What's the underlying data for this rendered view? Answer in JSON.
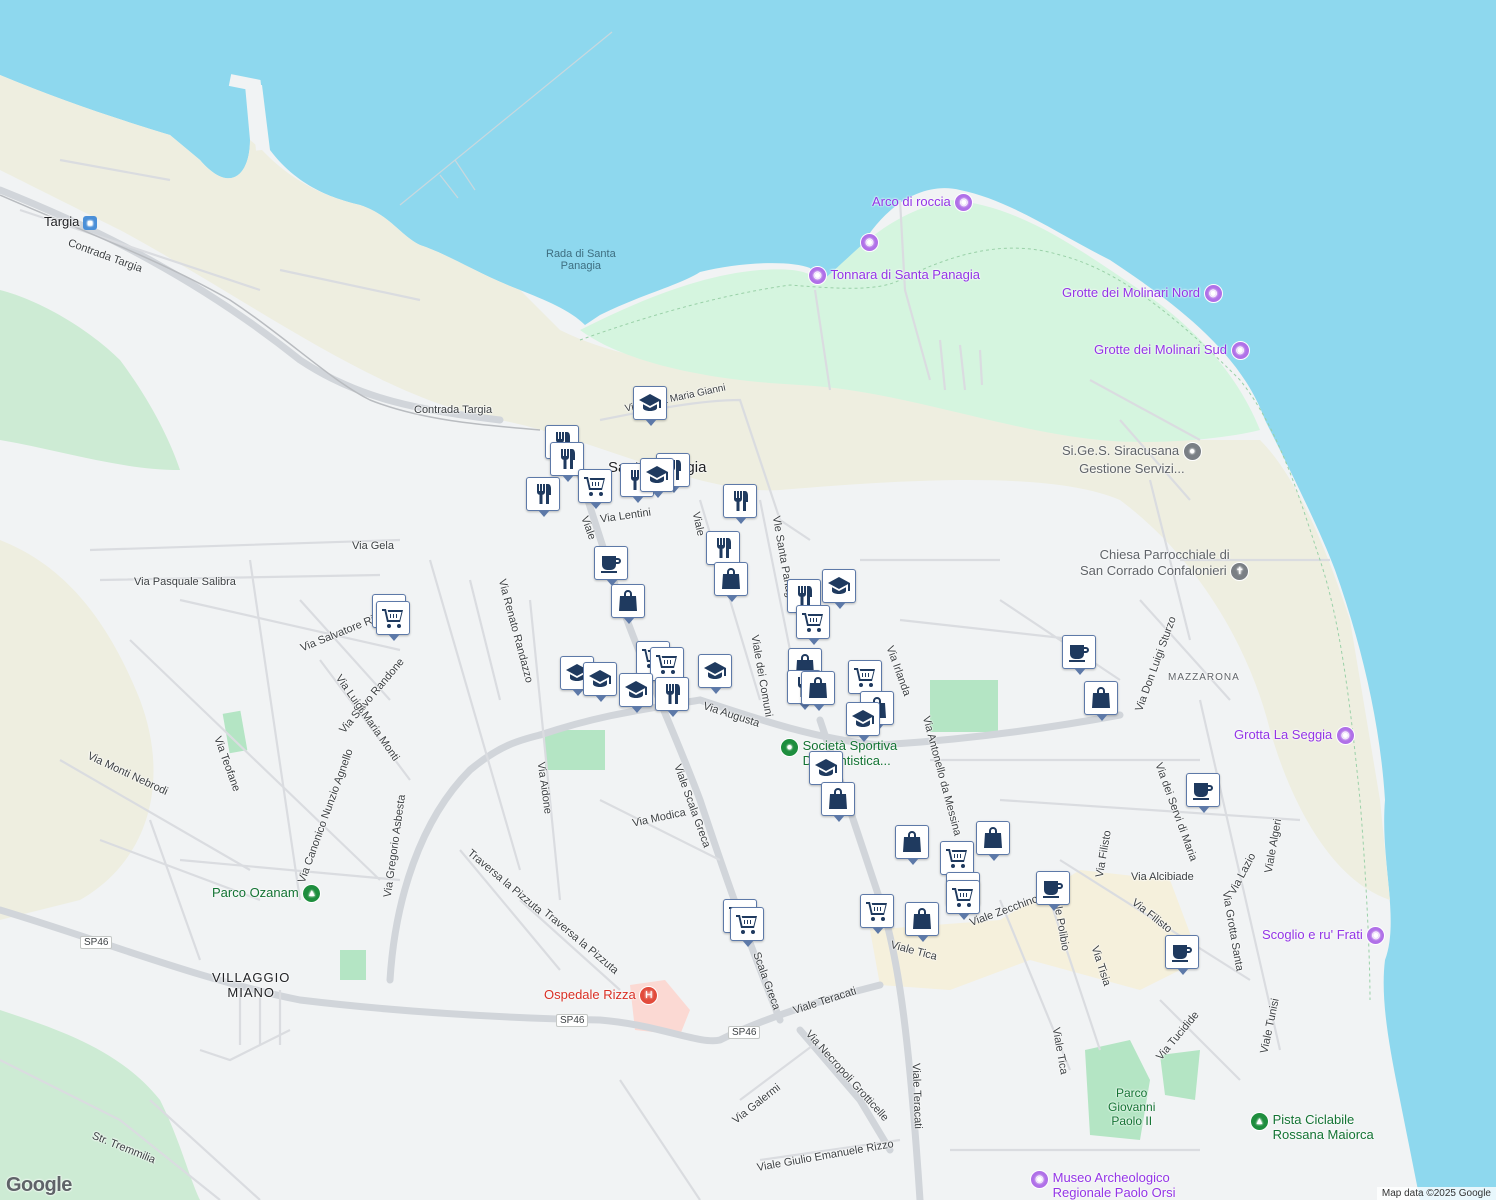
{
  "map": {
    "roads": [
      "Contrada Targia",
      "Via Santa Maria Gianni",
      "Via Lentini",
      "Via Gela",
      "Via Pasquale Salibra",
      "Via Salvatore Riz",
      "Via Salvo Randone",
      "Via Luigi Maria Monti",
      "Via Renato Randazzo",
      "Via Teofane",
      "Via Monti Nebrodi",
      "Via Canonico Nunzio Agnello",
      "Via Gregorio Asbesta",
      "Via Aidone",
      "Via Modica",
      "Viale Scala Greca",
      "Traversa la Pizzuta",
      "Traversa la Pizzuta",
      "Via Augusta",
      "Viale dei Comuni",
      "Vle Santa Panagia",
      "Via Irlanda",
      "Via Antonello da Messina",
      "Via Don Luigi Sturzo",
      "Via dei Servi di Maria",
      "Via Filisto",
      "Via Filisto",
      "Via Alcibiade",
      "Via Lazio",
      "Viale Algeri",
      "Via Grotta Santa",
      "Viale Zecchino",
      "Viale Polibio",
      "Viale Tica",
      "Viale Tica",
      "Via Tisia",
      "Viale Teracati",
      "Viale Teracati",
      "Scala Greca",
      "Via Necropoli Grotticelle",
      "Via Galermi",
      "Viale Giulio Emanuele Rizzo",
      "Str. Tremmilia",
      "Via Tucidide",
      "Viale Tunisi",
      "Viale"
    ],
    "places": [
      "Targia",
      "Rada di Santa",
      "Panagia",
      "Santa Panagia",
      "VILLAGGIO",
      "MIANO",
      "MAZZARONA"
    ],
    "road_refs": [
      "SP46",
      "SP46",
      "SP46"
    ],
    "pois": [
      {
        "name": "Arco di roccia",
        "kind": "attraction"
      },
      {
        "name": "Tonnara di Santa Panagia",
        "kind": "attraction"
      },
      {
        "name": "Grotte dei Molinari Nord",
        "kind": "attraction"
      },
      {
        "name": "Grotte dei Molinari Sud",
        "kind": "attraction"
      },
      {
        "name": "Si.Ge.S. Siracusana",
        "name2": "Gestione Servizi...",
        "kind": "business"
      },
      {
        "name": "Chiesa Parrocchiale di",
        "name2": "San Corrado Confalonieri",
        "kind": "church"
      },
      {
        "name": "Grotta La Seggia",
        "kind": "attraction"
      },
      {
        "name": "Scoglio e ru' Frati",
        "kind": "attraction"
      },
      {
        "name": "Società Sportiva",
        "name2": "Dilettantistica...",
        "kind": "sport"
      },
      {
        "name": "Parco Ozanam",
        "kind": "park"
      },
      {
        "name": "Ospedale Rizza",
        "kind": "hospital"
      },
      {
        "name": "Parco",
        "name2": "Giovanni",
        "name3": "Paolo II",
        "kind": "park"
      },
      {
        "name": "Pista Ciclabile",
        "name2": "Rossana Maiorca",
        "kind": "park"
      },
      {
        "name": "Museo Archeologico",
        "name2": "Regionale Paolo Orsi",
        "kind": "attraction"
      }
    ],
    "attribution": "Map data ©2025 Google",
    "logo": "Google"
  }
}
